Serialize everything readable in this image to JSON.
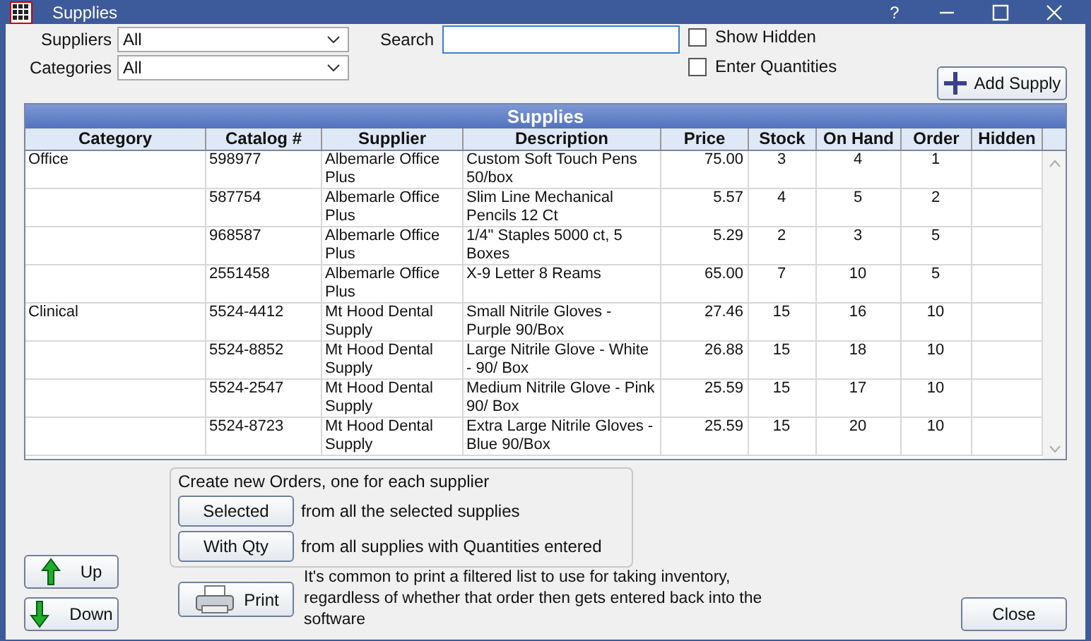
{
  "window": {
    "title": "Supplies",
    "controls": [
      "?"
    ]
  },
  "filters": [
    {
      "label": "Suppliers",
      "value": "All"
    },
    {
      "label": "Categories",
      "value": "All"
    }
  ],
  "search": {
    "label": "Search"
  },
  "checkboxes": [
    {
      "label": "Show Hidden",
      "checked": false
    },
    {
      "label": "Enter Quantities",
      "checked": false
    }
  ],
  "add_button": "Add Supply",
  "table": {
    "title": "Supplies",
    "columns": [
      "Category",
      "Catalog #",
      "Supplier",
      "Description",
      "Price",
      "Stock",
      "On Hand",
      "Order",
      "Hidden"
    ],
    "rows": [
      {
        "cells": [
          "Office",
          "598977",
          "Albemarle Office Plus",
          "Custom Soft Touch Pens 50/box",
          "75.00",
          "3",
          "4",
          "1"
        ]
      },
      {
        "cells": [
          "",
          "587754",
          "Albemarle Office Plus",
          "Slim Line Mechanical Pencils 12 Ct",
          "5.57",
          "4",
          "5",
          "2"
        ]
      },
      {
        "cells": [
          "",
          "968587",
          "Albemarle Office Plus",
          "1/4\" Staples 5000 ct, 5 Boxes",
          "5.29",
          "2",
          "3",
          "5"
        ]
      },
      {
        "cells": [
          "",
          "2551458",
          "Albemarle Office Plus",
          "X-9 Letter 8 Reams",
          "65.00",
          "7",
          "10",
          "5"
        ]
      },
      {
        "cells": [
          "Clinical",
          "5524-4412",
          "Mt Hood Dental Supply",
          "Small Nitrile Gloves - Purple 90/Box",
          "27.46",
          "15",
          "16",
          "10"
        ]
      },
      {
        "cells": [
          "",
          "5524-8852",
          "Mt Hood Dental Supply",
          "Large Nitrile Glove - White - 90/ Box",
          "26.88",
          "15",
          "18",
          "10"
        ]
      },
      {
        "cells": [
          "",
          "5524-2547",
          "Mt Hood Dental Supply",
          "Medium Nitrile Glove - Pink 90/ Box",
          "25.59",
          "15",
          "17",
          "10"
        ]
      },
      {
        "cells": [
          "",
          "5524-8723",
          "Mt Hood Dental Supply",
          "Extra Large Nitrile Gloves - Blue 90/Box",
          "25.59",
          "15",
          "20",
          "10"
        ]
      }
    ]
  },
  "order_group": {
    "caption": "Create new Orders, one for each supplier",
    "actions": [
      {
        "button": "Selected",
        "text": "from all the selected supplies"
      },
      {
        "button": "With Qty",
        "text": "from all supplies with Quantities entered"
      }
    ]
  },
  "move_buttons": [
    {
      "label": "Up",
      "kind": "up"
    },
    {
      "label": "Down",
      "kind": "down"
    }
  ],
  "print": {
    "button": "Print",
    "note": "It's common to print a filtered list to use for taking inventory, regardless of whether that order then gets entered back into the software"
  },
  "close_button": "Close"
}
